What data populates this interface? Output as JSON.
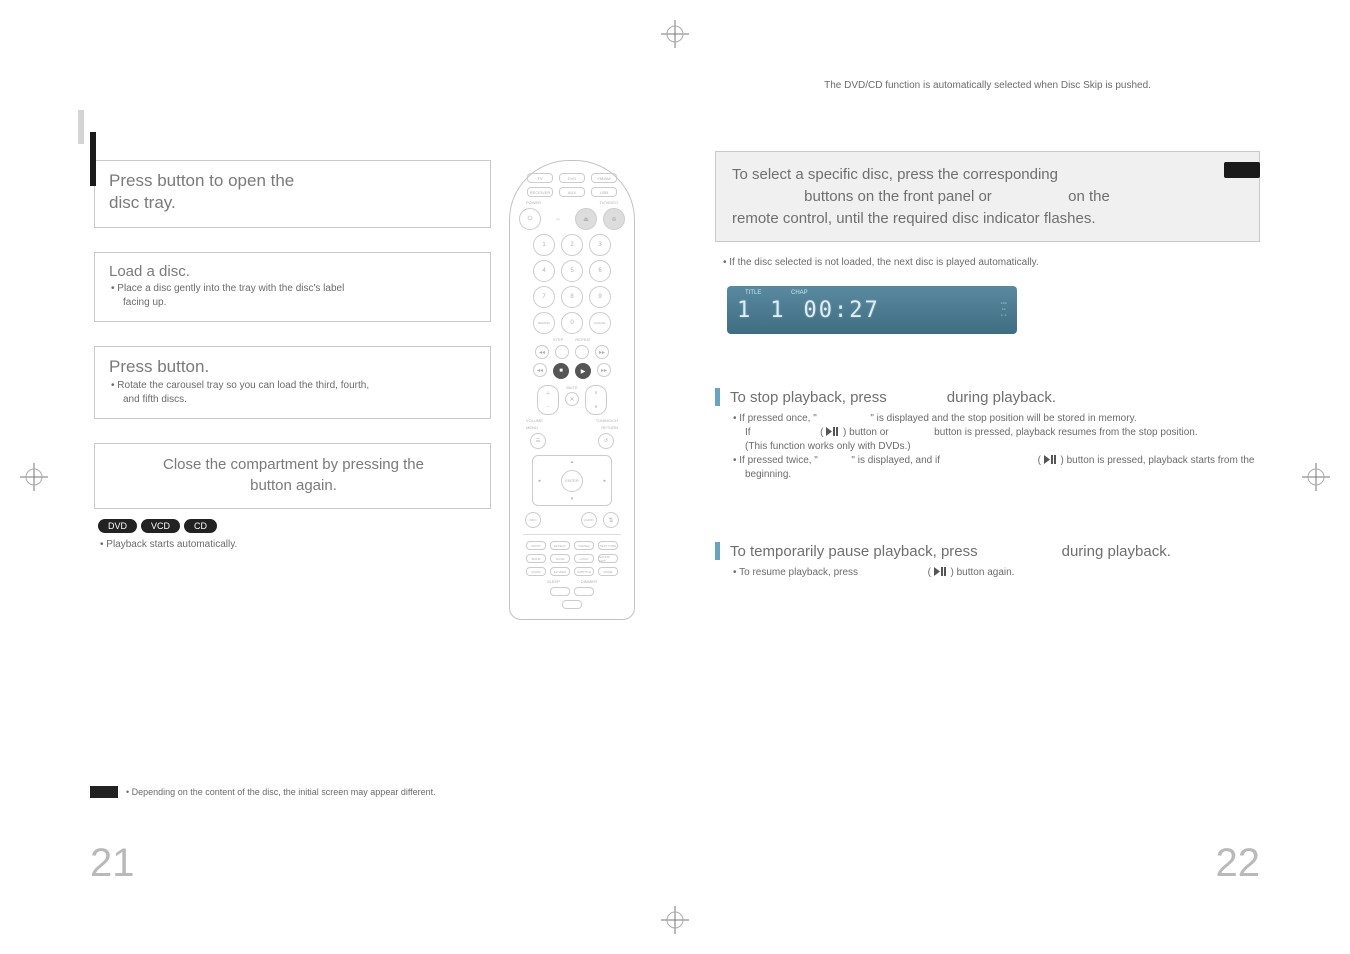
{
  "meta": {
    "subhead": "The DVD/CD function is automatically selected when Disc Skip is pushed."
  },
  "left_page": {
    "step1": {
      "t1": "Press ",
      "t2": " button to open the",
      "t3": "disc tray."
    },
    "step2": {
      "title": "Load a disc.",
      "d1": "• Place a disc gently into the tray with the disc's label",
      "d2": "facing up."
    },
    "step3": {
      "t1": "Press ",
      "t2": " button.",
      "d1": "• Rotate the carousel tray so you can load the third, fourth,",
      "d2": "and fifth discs."
    },
    "step4": {
      "t1": "Close the compartment by pressing the",
      "t2": " button again."
    },
    "pills": {
      "a": "DVD",
      "b": "VCD",
      "c": "CD"
    },
    "pill_note": "• Playback starts automatically.",
    "footnote": "• Depending on the content of the disc, the initial screen may appear different.",
    "page_number": "21"
  },
  "remote_labels": {
    "row1": [
      "TV",
      "DVD",
      "FM/AM"
    ],
    "row2": [
      "RECEIVER",
      "AUX",
      "USB"
    ],
    "power": "POWER",
    "tvvideo": "TV/VIDEO",
    "num": [
      "1",
      "2",
      "3",
      "4",
      "5",
      "6",
      "7",
      "8",
      "9",
      "0"
    ],
    "remain": "REMAIN",
    "cancel": "CANCEL",
    "step": "STEP",
    "repeat": "REPEAT",
    "mute": "MUTE",
    "volume": "VOLUME",
    "tuning": "TUNING/CH",
    "menu": "MENU",
    "return": "RETURN",
    "enter": "ENTER",
    "info": "INFO",
    "audio": "AUDIO",
    "ezview": "EZ VIEW",
    "subtitle": "SUBTITLE",
    "mo_st": "MO/ST",
    "sleep": "SLEEP",
    "dimmer": "DIMMER",
    "sdhd": "SD/HD",
    "hdmi_audio": "HDMI AUDIO",
    "psm": "P.SCAN",
    "slow": "SLOW",
    "logo": "LOGO",
    "sedit": "SOUND EDIT",
    "zoom": "ZOOM",
    "dispgroup": "DSP/EQ",
    "pl": "PL II",
    "mode": "MODE",
    "effect": "EFFECT",
    "testtone": "TEST TONE"
  },
  "right_page": {
    "box": {
      "l1a": "To select a specific disc, press the corresponding",
      "l1b": "",
      "l2a": " buttons on the front panel or ",
      "l2b": " on the",
      "l3": "remote control, until the required disc indicator flashes."
    },
    "box_note": "• If the disc selected is not loaded, the next disc is played automatically.",
    "lcd": {
      "title": "TITLE",
      "chap": "CHAP",
      "t": "1",
      "c": "1",
      "time": "00:27"
    },
    "stop": {
      "title_a": "To stop playback, press ",
      "title_b": " during playback.",
      "d1a": "• If pressed once, \" ",
      "d1b": "\" is displayed and the stop position will be stored in memory.",
      "d2a": "If ",
      "d2b": " (",
      "d2c": " ) button or ",
      "d2d": " button is pressed, playback resumes from the stop position.",
      "d3": "(This function works only with DVDs.)",
      "d4a": "• If pressed twice, \" ",
      "d4b": "\" is displayed, and if ",
      "d4c": " (",
      "d4d": " ) button is pressed, playback starts from the",
      "d5": "beginning."
    },
    "pause": {
      "title_a": "To temporarily pause playback, press ",
      "title_b": " during playback.",
      "d1a": "• To resume playback, press ",
      "d1b": " (",
      "d1c": " ) button again."
    },
    "page_number": "22"
  }
}
